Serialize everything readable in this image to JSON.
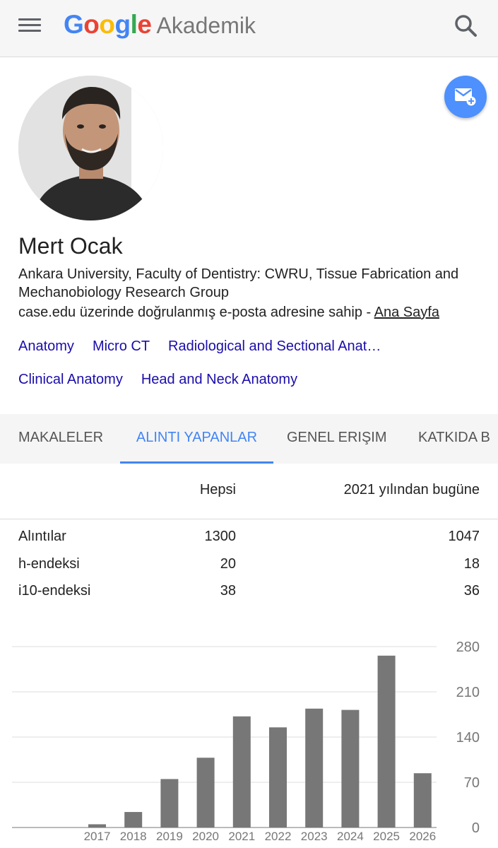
{
  "header": {
    "logo_letters": [
      "G",
      "o",
      "o",
      "g",
      "l",
      "e"
    ],
    "logo_colors": [
      "#4285f4",
      "#ea4335",
      "#fbbc05",
      "#4285f4",
      "#34a853",
      "#ea4335"
    ],
    "product": "Akademik",
    "menu_icon": "hamburger-menu-icon",
    "search_icon": "search-icon"
  },
  "profile": {
    "name": "Mert Ocak",
    "affiliation": "Ankara University, Faculty of Dentistry: CWRU, Tissue Fabrication and Mechanobiology Research Group",
    "verified_text": "case.edu üzerinde doğrulanmış e-posta adresine sahip - ",
    "homepage_label": "Ana Sayfa",
    "follow_icon": "mail-follow-icon",
    "accent_color": "#4d90fe"
  },
  "interests": [
    "Anatomy",
    "Micro CT",
    "Radiological and Sectional Anat…",
    "Clinical Anatomy",
    "Head and Neck Anatomy"
  ],
  "tabs": [
    {
      "label": "MAKALELER",
      "active": false
    },
    {
      "label": "ALINTI YAPANLAR",
      "active": true
    },
    {
      "label": "GENEL ERIŞIM",
      "active": false
    },
    {
      "label": "KATKIDA B",
      "active": false
    }
  ],
  "stats": {
    "col_all": "Hepsi",
    "col_recent": "2021 yılından bugüne",
    "rows": [
      {
        "label": "Alıntılar",
        "all": "1300",
        "recent": "1047"
      },
      {
        "label": "h-endeksi",
        "all": "20",
        "recent": "18"
      },
      {
        "label": "i10-endeksi",
        "all": "38",
        "recent": "36"
      }
    ]
  },
  "chart_data": {
    "type": "bar",
    "categories": [
      "2017",
      "2018",
      "2019",
      "2020",
      "2021",
      "2022",
      "2023",
      "2024",
      "2025",
      "2026"
    ],
    "values": [
      5,
      24,
      75,
      108,
      172,
      155,
      184,
      182,
      266,
      84
    ],
    "ylim": [
      0,
      280
    ],
    "yticks": [
      "0",
      "70",
      "140",
      "210",
      "280"
    ],
    "grid": true,
    "bar_color": "#777777"
  }
}
